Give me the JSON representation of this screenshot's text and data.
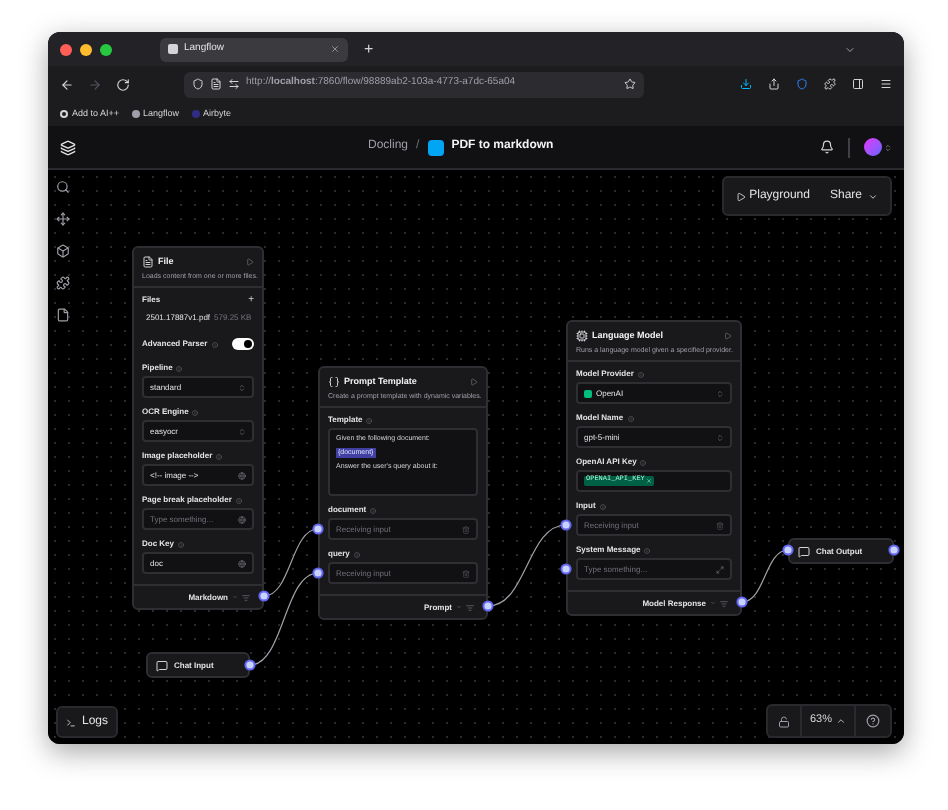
{
  "browser": {
    "tab": "Langflow",
    "new_tab": "+",
    "url": "http://**localhost**:7860/flow/98889ab2-103a-4773-a7dc-65a04",
    "bookmarks": [
      "Add to AI++",
      "Langflow",
      "Airbyte"
    ]
  },
  "header": {
    "project": "Docling",
    "separator": "/",
    "flow": "PDF to markdown"
  },
  "toolbar": {
    "playground": "Playground",
    "share": "Share"
  },
  "nodes": [
    {
      "kind": "component",
      "title": "File",
      "description": "Loads content from one or more files.",
      "output": "Markdown",
      "fields": [
        {
          "kind": "files",
          "label": "Files",
          "add": "+",
          "file": "2501.17887v1.pdf",
          "size": "579.25 KB"
        },
        {
          "kind": "toggle",
          "label": "Advanced Parser",
          "on": true
        },
        {
          "kind": "select",
          "label": "Pipeline",
          "value": "standard"
        },
        {
          "kind": "select",
          "label": "OCR Engine",
          "value": "easyocr"
        },
        {
          "kind": "input",
          "label": "Image placeholder",
          "value": "<!-- image -->"
        },
        {
          "kind": "input",
          "label": "Page break placeholder",
          "placeholder": "Type something..."
        },
        {
          "kind": "input",
          "label": "Doc Key",
          "value": "doc"
        }
      ]
    },
    {
      "kind": "component",
      "title": "Prompt Template",
      "description": "Create a prompt template with dynamic variables.",
      "output": "Prompt",
      "fields": [
        {
          "kind": "template",
          "label": "Template",
          "lines": [
            {
              "text": "Given the following document:",
              "variable": false
            },
            {
              "text": "{document}",
              "variable": true
            },
            {
              "text": "Answer the user's query about it:",
              "variable": false
            }
          ]
        },
        {
          "kind": "receiver",
          "label": "document",
          "placeholder": "Receiving input"
        },
        {
          "kind": "receiver",
          "label": "query",
          "placeholder": "Receiving input"
        }
      ]
    },
    {
      "kind": "component",
      "title": "Language Model",
      "description": "Runs a language model given a specified provider.",
      "output": "Model Response",
      "fields": [
        {
          "kind": "provider",
          "label": "Model Provider",
          "value": "OpenAI"
        },
        {
          "kind": "select",
          "label": "Model Name",
          "value": "gpt-5-mini"
        },
        {
          "kind": "key",
          "label": "OpenAI API Key",
          "value": "OPENAI_API_KEY"
        },
        {
          "kind": "receiver",
          "label": "Input",
          "placeholder": "Receiving input"
        },
        {
          "kind": "textarea",
          "label": "System Message",
          "placeholder": "Type something..."
        }
      ]
    },
    {
      "kind": "compact",
      "title": "Chat Output"
    },
    {
      "kind": "compact",
      "title": "Chat Input"
    }
  ],
  "logs": "Logs",
  "zoom": "63%"
}
